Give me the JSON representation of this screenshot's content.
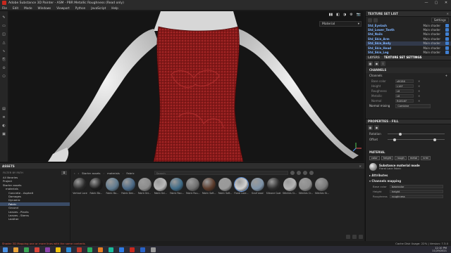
{
  "window": {
    "title": "Adobe Substance 3D Painter - ASM - PBR Metallic Roughness (Read only)",
    "controls": [
      "—",
      "▢",
      "✕"
    ]
  },
  "menu": [
    "File",
    "Edit",
    "Mode",
    "Windows",
    "Viewport",
    "Python",
    "JavaScript",
    "Help"
  ],
  "viewport": {
    "mode_select": "Material",
    "toolbar": [
      "▮▮",
      "◧",
      "◑",
      "⚙",
      "📷"
    ]
  },
  "texture_set_list": {
    "title": "TEXTURE SET LIST",
    "settings_label": "Settings",
    "sets": [
      {
        "name": "Std_Eyelash",
        "shader": "Main shader"
      },
      {
        "name": "Std_Lower_Teeth",
        "shader": "Main shader"
      },
      {
        "name": "Std_Nails",
        "shader": "Main shader"
      },
      {
        "name": "Std_Skin_Arm",
        "shader": "Main shader"
      },
      {
        "name": "Std_Skin_Body",
        "shader": "Main shader"
      },
      {
        "name": "Std_Skin_Head",
        "shader": "Main shader"
      },
      {
        "name": "Std_Skin_Leg",
        "shader": "Main shader"
      }
    ]
  },
  "texture_set_settings": {
    "tabs": [
      "LAYERS",
      "TEXTURE SET SETTINGS"
    ],
    "channels_header": "CHANNELS",
    "channels_label": "Channels",
    "channels": [
      {
        "name": "Base color",
        "format": "sRGB8"
      },
      {
        "name": "Height",
        "format": "L16F"
      },
      {
        "name": "Roughness",
        "format": "L8"
      },
      {
        "name": "Metallic",
        "format": "L8"
      },
      {
        "name": "Normal",
        "format": "RGB16F"
      }
    ],
    "normal_mixing_label": "Normal mixing",
    "normal_mixing_value": "Combine"
  },
  "properties": {
    "title": "PROPERTIES - FILL",
    "sliders": [
      {
        "label": "Rotation"
      },
      {
        "label": "Offset"
      }
    ],
    "material_header": "MATERIAL",
    "material_buttons": [
      "color",
      "height",
      "rough",
      "metal",
      "nrmi"
    ],
    "substance_title": "Substance material mode",
    "substance_name": "Floral Lace Fabric",
    "attributes_header": "Attributes",
    "channels_mapping_header": "Channels mapping",
    "mapping": [
      {
        "key": "Base color",
        "value": "basecolor"
      },
      {
        "key": "Height",
        "value": "height"
      },
      {
        "key": "Roughness",
        "value": "roughness"
      }
    ]
  },
  "assets": {
    "title": "ASSETS",
    "filter_placeholder": "FILTER BY PATH",
    "tree": [
      "All libraries",
      "Project",
      "Starter assets",
      "materials",
      "Concrete - Asphalt",
      "Damages",
      "Dynamic",
      "Fabric",
      "Ground",
      "Leaves - Plants",
      "Leaves - Stems",
      "Leather"
    ],
    "selected_tree_index": 7,
    "breadcrumbs": [
      "Starter assets",
      "materials",
      "Fabric"
    ],
    "search_placeholder": "Search",
    "items": [
      {
        "label": "Vertical Lace",
        "color": "#2a2a2a"
      },
      {
        "label": "Fabric Ba...",
        "color": "#1c1c1c"
      },
      {
        "label": "Fabric Ba...",
        "color": "#5f7a8f"
      },
      {
        "label": "Fabric Den...",
        "color": "#496784"
      },
      {
        "label": "Fabric Kni...",
        "color": "#8c8c8c"
      },
      {
        "label": "Fabric Kni...",
        "color": "#b9b9b9"
      },
      {
        "label": "Fabric Rou...",
        "color": "#3e6a86"
      },
      {
        "label": "Fabric Rou...",
        "color": "#6f6f6f"
      },
      {
        "label": "Fabric Soft...",
        "color": "#5a3a2a"
      },
      {
        "label": "Fabric Soft...",
        "color": "#9a9a9a"
      },
      {
        "label": "Floral Lace...",
        "color": "#d0d0d0"
      },
      {
        "label": "Scarf wool",
        "color": "#7e93a8"
      },
      {
        "label": "Silicone Coat",
        "color": "#2c2c2c"
      },
      {
        "label": "Stitches Cr...",
        "color": "#b5b5b5"
      },
      {
        "label": "Stitches Cr...",
        "color": "#8e8e8e"
      },
      {
        "label": "Stitches St...",
        "color": "#7a7a7a"
      }
    ],
    "selected_item_index": 10
  },
  "status": {
    "error": "Shader 3D Mapping one or more lines with the same contents",
    "right": "Cache Disk Usage: 22% | Version: 7.3.0"
  },
  "taskbar": {
    "time": "12:10 PM",
    "date": "11/29/2021",
    "apps": [
      "#4a90e2",
      "#e8a33b",
      "#3aa655",
      "#d9453a",
      "#8e44ad",
      "#f1c40f",
      "#2d8cd6",
      "#c0392b",
      "#27ae60",
      "#e67e22",
      "#1abc9c",
      "#2d7be5",
      "#c8281e",
      "#2962c6",
      "#999999"
    ]
  },
  "colors": {
    "accent": "#5e8fd6",
    "dress": "#8c1f1f",
    "error_text": "#e15b4a"
  }
}
